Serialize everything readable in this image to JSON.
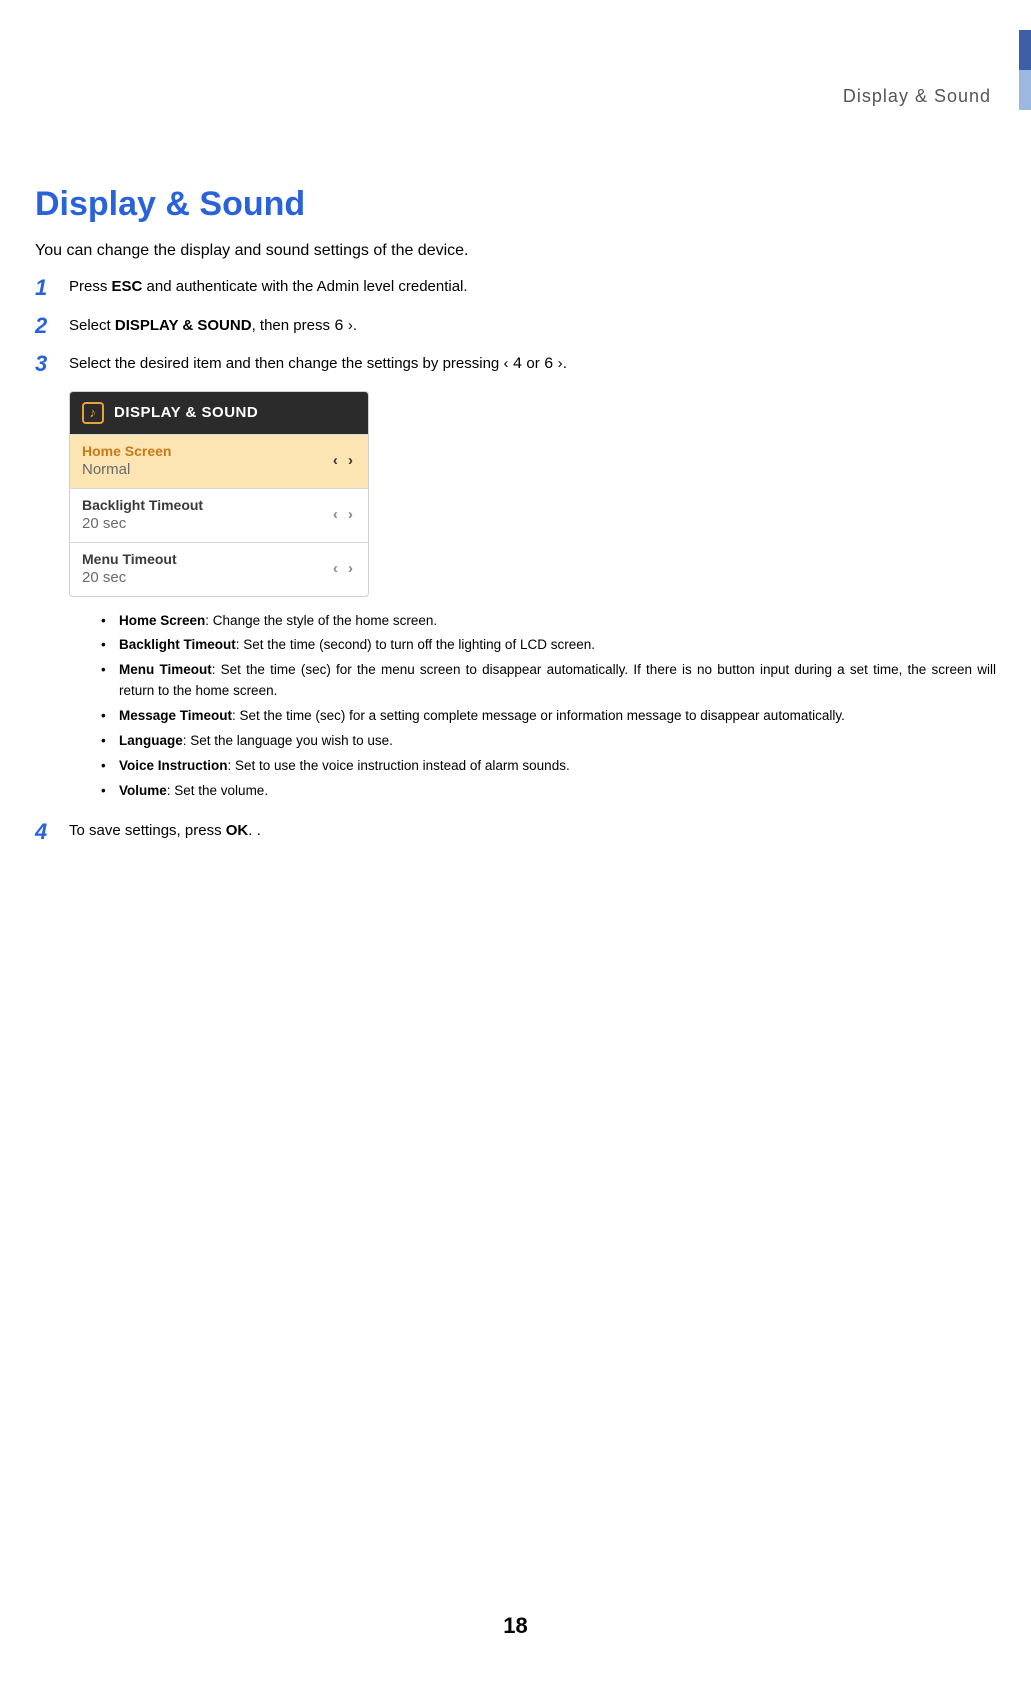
{
  "header": {
    "section_label": "Display  &  Sound"
  },
  "title": "Display & Sound",
  "intro": "You can change the display and sound settings of the device.",
  "steps": {
    "s1": {
      "num": "1",
      "pre": "Press ",
      "bold": "ESC",
      "post": " and authenticate with the Admin level credential."
    },
    "s2": {
      "num": "2",
      "pre": "Select ",
      "bold": "DISPLAY & SOUND",
      "post1": ", then press ",
      "key1": "6",
      "post2": "."
    },
    "s3": {
      "num": "3",
      "text_pre": "Select the desired item and then change the settings by pressing ",
      "key1": "4",
      "mid": " or ",
      "key2": "6",
      "text_post": "."
    },
    "s4": {
      "num": "4",
      "pre": "To save settings, press ",
      "bold": "OK",
      "post": ". ."
    }
  },
  "screenshot": {
    "header_title": "DISPLAY & SOUND",
    "rows": [
      {
        "label": "Home Screen",
        "value": "Normal",
        "selected": true
      },
      {
        "label": "Backlight Timeout",
        "value": "20 sec",
        "selected": false
      },
      {
        "label": "Menu Timeout",
        "value": "20 sec",
        "selected": false
      }
    ],
    "arrows": "‹ ›"
  },
  "bullets": [
    {
      "term": "Home Screen",
      "desc": ": Change the style of the home screen."
    },
    {
      "term": "Backlight Timeout",
      "desc": ": Set the time (second) to turn off the lighting of LCD screen."
    },
    {
      "term": "Menu Timeout",
      "desc": ": Set the time (sec) for the menu screen to disappear automatically. If there is no button input during a set time, the screen will return to the home screen."
    },
    {
      "term": "Message Timeout",
      "desc": ": Set the time (sec) for a setting complete message or information message to disappear automatically."
    },
    {
      "term": "Language",
      "desc": ": Set the language you wish to use."
    },
    {
      "term": "Voice Instruction",
      "desc": ": Set to use the voice instruction instead of alarm sounds."
    },
    {
      "term": "Volume",
      "desc": ": Set the volume."
    }
  ],
  "page_number": "18"
}
